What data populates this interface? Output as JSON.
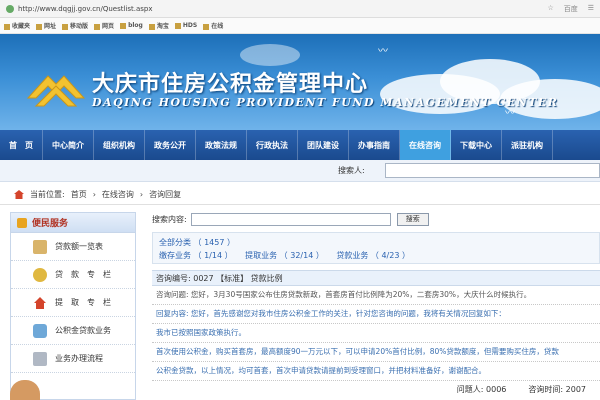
{
  "browser": {
    "url": "http://www.dqgjj.gov.cn/Questlist.aspx",
    "right_items": [
      "☆",
      "百度",
      "☰"
    ],
    "bookmarks": [
      "收藏夹",
      "网址",
      "移动版",
      "网页",
      "blog",
      "淘宝",
      "HDS",
      "在线"
    ]
  },
  "banner": {
    "title_cn": "大庆市住房公积金管理中心",
    "title_en": "DAQING HOUSING PROVIDENT FUND MANAGEMENT CENTER"
  },
  "nav": {
    "items": [
      "首　页",
      "中心简介",
      "组织机构",
      "政务公开",
      "政策法规",
      "行政执法",
      "团队建设",
      "办事指南",
      "在线咨询",
      "下载中心",
      "派驻机构"
    ],
    "active_index": 8
  },
  "search": {
    "label": "搜索人:"
  },
  "breadcrumb": {
    "prefix": "当前位置:",
    "items": [
      "首页",
      "在线咨询",
      "咨询回复"
    ]
  },
  "sidebar": {
    "header": "便民服务",
    "items": [
      "贷款额一览表",
      "贷　款　专　栏",
      "提　取　专　栏",
      "公积金贷款业务",
      "业务办理流程"
    ]
  },
  "main": {
    "question_label": "搜索内容:",
    "search_button": "搜索",
    "all_category": "全部分类 （ 1457 ）",
    "sub_categories": [
      "缴存业务 （ 1/14 ）",
      "提取业务 （ 32/14 ）",
      "贷款业务 （ 4/23 ）"
    ],
    "question_title": "咨询编号: 0027 【标准】 贷款比例",
    "question_body": "咨询问题: 您好，3月30号国家公布住房贷款新政，首套房首付比例降为20%，二套房30%，大庆什么时候执行。",
    "reply_body": "回复内容: 您好，首先感谢您对我市住房公积金工作的关注，针对您咨询的问题，我将有关情况回复如下：",
    "reply_line2": "我市已按照国家政策执行。",
    "note_body": "首次使用公积金，购买首套房，最高额度90一万元以下，可以申请20%首付比例，80%贷款额度，但需要购买住房，贷款",
    "note_line2": "公积金贷款，以上情况，均可首套，首次申请贷款请提前到受理窗口，并把材料准备好，谢谢配合。",
    "footer": {
      "asker_label": "问题人:",
      "asker": "0006",
      "date_label": "咨询时间:",
      "date": "2007"
    }
  }
}
